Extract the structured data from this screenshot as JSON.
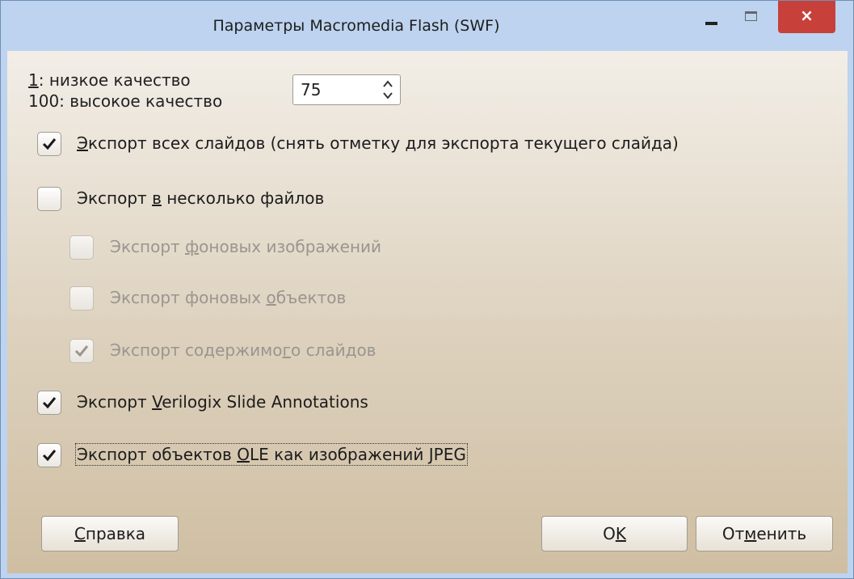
{
  "window": {
    "title": "Параметры Macromedia Flash (SWF)",
    "controls": {
      "minimize": "minimize",
      "maximize": "maximize",
      "close": "×"
    }
  },
  "quality": {
    "low_key": "1",
    "low_rest": ": низкое качество",
    "high_label": "100: высокое качество",
    "value": "75"
  },
  "options": [
    {
      "pre": "",
      "u": "Э",
      "post": "кспорт всех слайдов (снять отметку для экспорта текущего слайда)",
      "checked": true,
      "disabled": false
    },
    {
      "pre": "Экспорт ",
      "u": "в",
      "post": " несколько файлов",
      "checked": false,
      "disabled": false
    },
    {
      "pre": "Экспорт ",
      "u": "ф",
      "post": "оновых изображений",
      "checked": false,
      "disabled": true
    },
    {
      "pre": "Экспорт фоновых ",
      "u": "о",
      "post": "бъектов",
      "checked": false,
      "disabled": true
    },
    {
      "pre": "Экспорт содержимо",
      "u": "г",
      "post": "о слайдов",
      "checked": true,
      "disabled": true
    },
    {
      "pre": "Экспорт ",
      "u": "V",
      "post": "erilogix Slide Annotations",
      "checked": true,
      "disabled": false
    },
    {
      "pre": "Экспорт объектов ",
      "u": "O",
      "post": "LE как изображений JPEG",
      "checked": true,
      "disabled": false
    }
  ],
  "buttons": {
    "help": {
      "u": "С",
      "post": "правка"
    },
    "ok": {
      "pre": "O",
      "u": "K",
      "post": ""
    },
    "cancel": {
      "pre": "От",
      "u": "м",
      "post": "енить"
    }
  }
}
